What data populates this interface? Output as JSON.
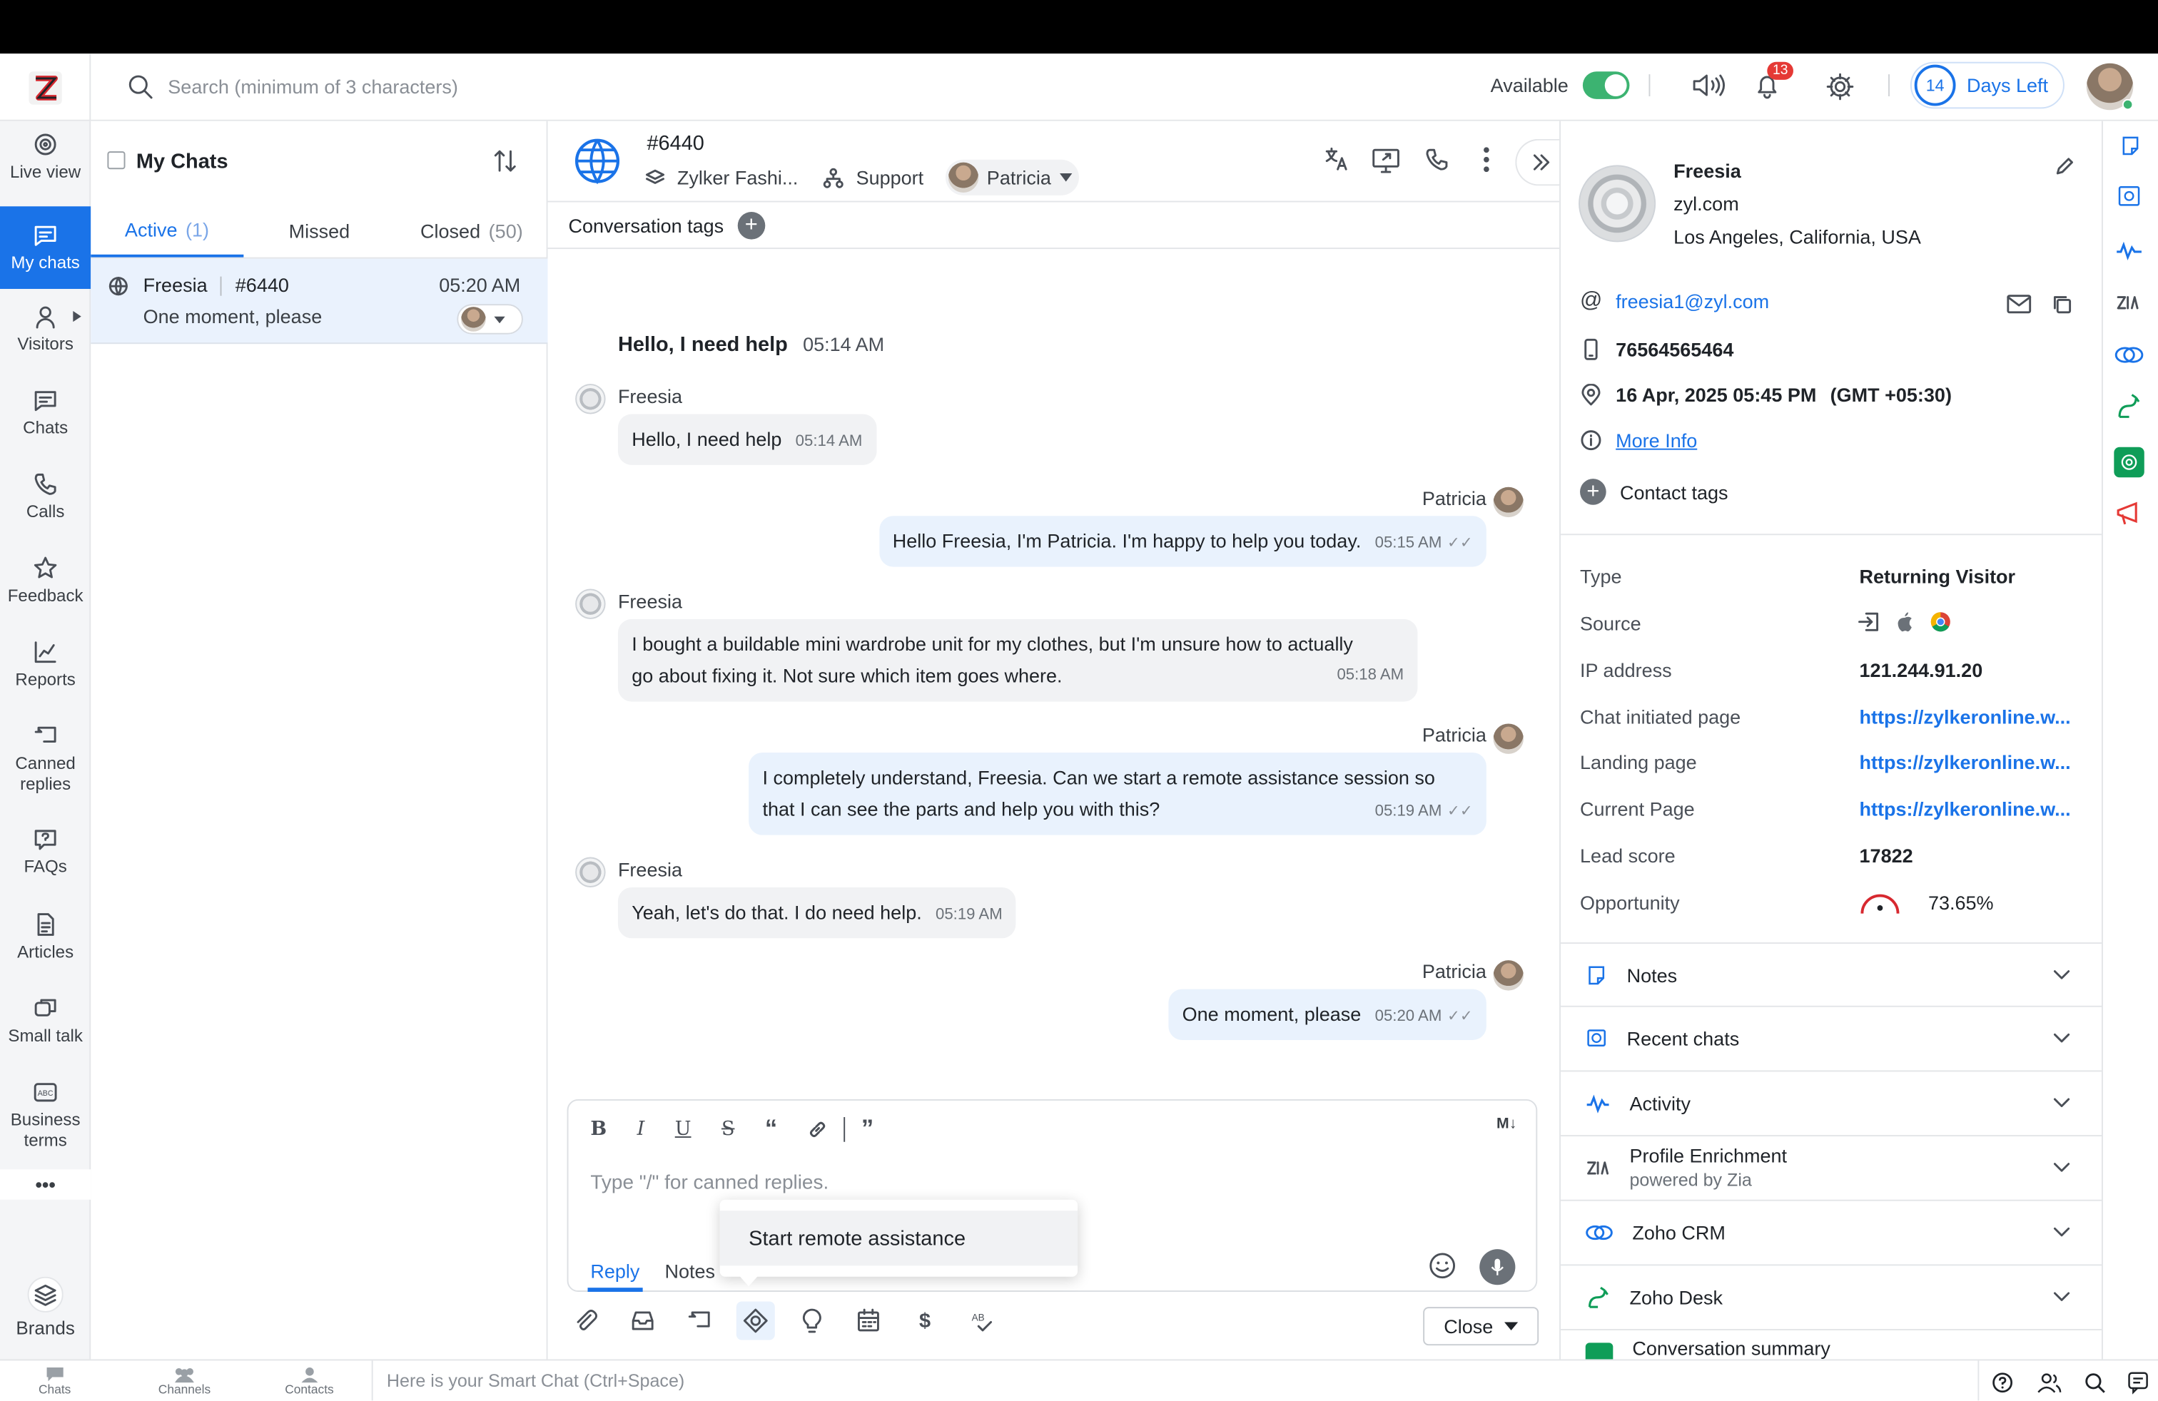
{
  "app": {
    "search_placeholder": "Search (minimum of 3 characters)",
    "status_label": "Available",
    "notif_count": "13",
    "days_num": "14",
    "days_label": "Days Left"
  },
  "nav": {
    "live_view": "Live view",
    "my_chats": "My chats",
    "visitors": "Visitors",
    "chats": "Chats",
    "calls": "Calls",
    "feedback": "Feedback",
    "reports": "Reports",
    "canned_replies": "Canned replies",
    "faqs": "FAQs",
    "articles": "Articles",
    "small_talk": "Small talk",
    "business_terms": "Business terms",
    "more": "•••",
    "brands": "Brands"
  },
  "list": {
    "title": "My Chats",
    "tabs": [
      {
        "label": "Active",
        "count": "(1)"
      },
      {
        "label": "Missed",
        "count": ""
      },
      {
        "label": "Closed",
        "count": "(50)"
      }
    ],
    "row": {
      "name": "Freesia",
      "id": "#6440",
      "time": "05:20 AM",
      "preview": "One moment, please"
    }
  },
  "conv": {
    "id": "#6440",
    "brand": "Zylker Fashi...",
    "dept": "Support",
    "agent": "Patricia",
    "tags_label": "Conversation tags",
    "question": "Hello, I need help",
    "question_time": "05:14 AM",
    "messages": [
      {
        "sender": "Freesia",
        "text": "Hello, I need help",
        "time": "05:14 AM"
      },
      {
        "sender": "Patricia",
        "text": "Hello Freesia, I'm Patricia. I'm happy to help you today.",
        "time": "05:15 AM"
      },
      {
        "sender": "Freesia",
        "line1": "I bought a buildable mini wardrobe unit for my clothes, but I'm unsure how to actually",
        "line2": "go about fixing it. Not sure which item goes where.",
        "time": "05:18 AM"
      },
      {
        "sender": "Patricia",
        "line1": "I completely understand, Freesia. Can we start a remote assistance session so",
        "line2": "that I can see the parts and help you with this?",
        "time": "05:19 AM"
      },
      {
        "sender": "Freesia",
        "text": "Yeah, let's do that. I do need help.",
        "time": "05:19 AM"
      },
      {
        "sender": "Patricia",
        "text": "One moment, please",
        "time": "05:20 AM"
      }
    ],
    "composer_placeholder": "Type \"/\" for canned replies.",
    "reply_tab": "Reply",
    "notes_tab": "Notes",
    "md_label": "M↓",
    "popup_item": "Start remote assistance",
    "close_label": "Close"
  },
  "visitor": {
    "name": "Freesia",
    "website": "zyl.com",
    "location": "Los Angeles, California, USA",
    "email": "freesia1@zyl.com",
    "phone": "76564565464",
    "datetime": "16 Apr, 2025 05:45 PM",
    "timezone": "(GMT +05:30)",
    "more_info": "More Info",
    "contact_tags": "Contact tags",
    "fields": [
      {
        "label": "Type",
        "value": "Returning Visitor"
      },
      {
        "label": "Source",
        "value": ""
      },
      {
        "label": "IP address",
        "value": "121.244.91.20"
      },
      {
        "label": "Chat initiated page",
        "value": "https://zylkeronline.w..."
      },
      {
        "label": "Landing page",
        "value": "https://zylkeronline.w..."
      },
      {
        "label": "Current Page",
        "value": "https://zylkeronline.w..."
      },
      {
        "label": "Lead score",
        "value": "17822"
      },
      {
        "label": "Opportunity",
        "value": "73.65%"
      }
    ],
    "sections": [
      "Notes",
      "Recent chats",
      "Activity",
      "Profile Enrichment",
      "Zoho CRM",
      "Zoho Desk",
      "Conversation summary"
    ],
    "enrichment_sub": "powered by Zia"
  },
  "footer": {
    "chats": "Chats",
    "channels": "Channels",
    "contacts": "Contacts",
    "smart_chat_placeholder": "Here is your Smart Chat (Ctrl+Space)"
  },
  "colors": {
    "accent": "#1a73e8",
    "available": "#3cb371",
    "badge": "#e53935"
  }
}
